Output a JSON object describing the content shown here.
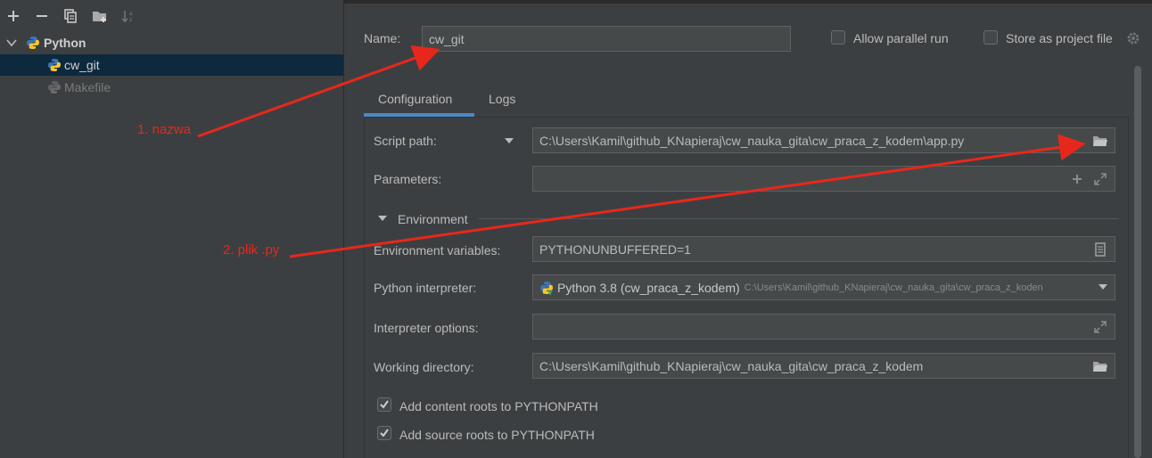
{
  "toolbar": {
    "add_icon": "plus-icon",
    "remove_icon": "minus-icon",
    "copy_icon": "copy-icon",
    "folder_icon": "new-folder-icon",
    "sort_icon": "sort-icon"
  },
  "tree": {
    "group_label": "Python",
    "items": [
      {
        "label": "cw_git",
        "selected": true
      },
      {
        "label": "Makefile",
        "selected": false
      }
    ]
  },
  "header": {
    "name_label": "Name:",
    "name_value": "cw_git",
    "allow_parallel_label": "Allow parallel run",
    "allow_parallel_checked": false,
    "store_project_label": "Store as project file",
    "store_project_checked": false
  },
  "tabs": [
    {
      "label": "Configuration",
      "active": true
    },
    {
      "label": "Logs",
      "active": false
    }
  ],
  "form": {
    "script_path_label": "Script path:",
    "script_path_value": "C:\\Users\\Kamil\\github_KNapieraj\\cw_nauka_gita\\cw_praca_z_kodem\\app.py",
    "parameters_label": "Parameters:",
    "parameters_value": "",
    "environment_label": "Environment",
    "env_vars_label": "Environment variables:",
    "env_vars_value": "PYTHONUNBUFFERED=1",
    "interpreter_label": "Python interpreter:",
    "interpreter_name": "Python 3.8 (cw_praca_z_kodem)",
    "interpreter_path": "C:\\Users\\Kamil\\github_KNapieraj\\cw_nauka_gita\\cw_praca_z_koden",
    "interpreter_options_label": "Interpreter options:",
    "interpreter_options_value": "",
    "working_dir_label": "Working directory:",
    "working_dir_value": "C:\\Users\\Kamil\\github_KNapieraj\\cw_nauka_gita\\cw_praca_z_kodem",
    "content_roots_label": "Add content roots to PYTHONPATH",
    "content_roots_checked": true,
    "source_roots_label": "Add source roots to PYTHONPATH",
    "source_roots_checked": true
  },
  "annotations": {
    "first": "1. nazwa",
    "second": "2. plik .py",
    "color": "#e8271c"
  },
  "colors": {
    "background": "#3c3f41",
    "selection": "#0d293e",
    "tab_accent": "#4a88c7",
    "field_bg": "#45494a"
  }
}
